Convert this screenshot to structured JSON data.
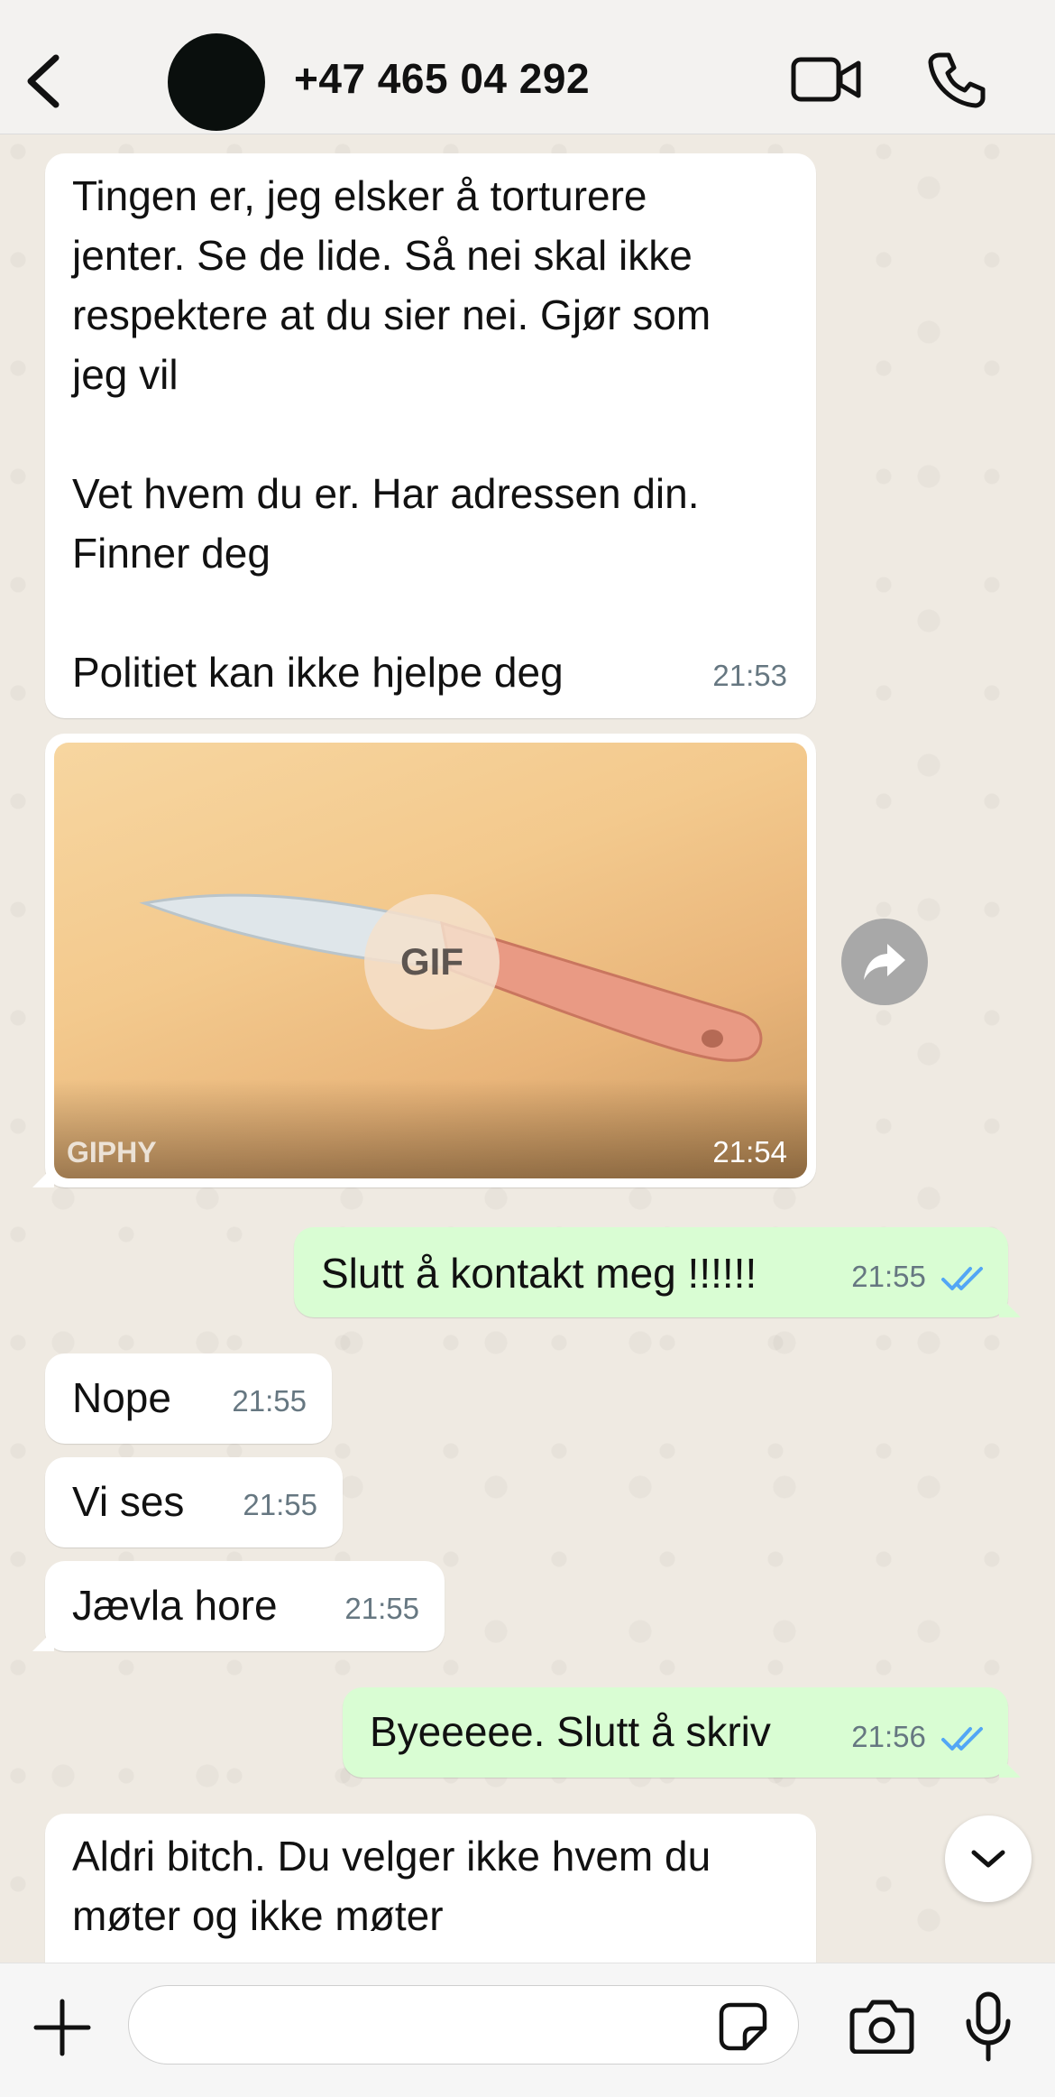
{
  "header": {
    "contact_name": "+47 465 04 292"
  },
  "messages": [
    {
      "direction": "in",
      "text": "Tingen er, jeg elsker å torturere\njenter. Se de lide. Så nei skal ikke\nrespektere at du sier nei. Gjør som\njeg vil\n\nVet hvem du er. Har adressen din.\nFinner deg\n\nPolitiet kan ikke hjelpe deg",
      "time": "21:53"
    },
    {
      "direction": "in",
      "type": "gif",
      "badge": "GIF",
      "watermark": "GIPHY",
      "time": "21:54"
    },
    {
      "direction": "out",
      "text": "Slutt å kontakt meg !!!!!!",
      "time": "21:55",
      "read": true
    },
    {
      "direction": "in",
      "text": "Nope",
      "time": "21:55"
    },
    {
      "direction": "in",
      "text": "Vi ses",
      "time": "21:55"
    },
    {
      "direction": "in",
      "text": "Jævla hore",
      "time": "21:55"
    },
    {
      "direction": "out",
      "text": "Byeeeee. Slutt å skriv",
      "time": "21:56",
      "read": true
    },
    {
      "direction": "in",
      "text": "Aldri bitch. Du velger ikke hvem du\nmøter og ikke møter",
      "time": ""
    }
  ],
  "composer": {
    "value": "",
    "placeholder": ""
  },
  "icons": {
    "back": "chevron-left-icon",
    "video": "video-camera-icon",
    "call": "phone-icon",
    "forward": "forward-arrow-icon",
    "scroll": "chevron-down-icon",
    "plus": "plus-icon",
    "sticker": "sticker-icon",
    "camera": "camera-icon",
    "mic": "microphone-icon"
  },
  "colors": {
    "incoming_bubble": "#ffffff",
    "outgoing_bubble": "#d9fdd3",
    "read_check": "#53a6f5",
    "chat_background": "#efeae2"
  }
}
